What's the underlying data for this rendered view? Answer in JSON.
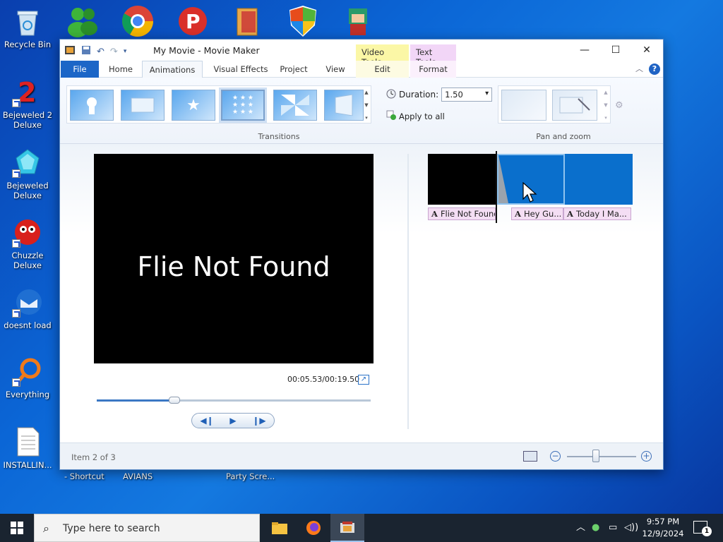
{
  "desktop": {
    "icons": [
      {
        "label": "Recycle Bin"
      },
      {
        "label": "Bejeweled 2 Deluxe"
      },
      {
        "label": "Bejeweled Deluxe"
      },
      {
        "label": "Chuzzle Deluxe"
      },
      {
        "label": "doesnt load"
      },
      {
        "label": "Everything"
      },
      {
        "label": "INSTALLIN..."
      }
    ],
    "partial_labels": [
      "- Shortcut",
      "AVIANS",
      "Party Scre..."
    ]
  },
  "window": {
    "title": "My Movie - Movie Maker",
    "context_tabs": {
      "video_tools": "Video Tools",
      "text_tools": "Text Tools"
    },
    "menu": {
      "file": "File",
      "home": "Home",
      "animations": "Animations",
      "visual_effects": "Visual Effects",
      "project": "Project",
      "view": "View",
      "edit": "Edit",
      "format": "Format"
    },
    "help_label": "?"
  },
  "ribbon": {
    "transitions_label": "Transitions",
    "duration_label": "Duration:",
    "duration_value": "1.50",
    "apply_all_label": "Apply to all",
    "pan_zoom_label": "Pan and zoom"
  },
  "preview": {
    "text": "Flie Not Found",
    "timecode": "00:05.53/00:19.50",
    "seek_progress": 0.284
  },
  "storyboard": {
    "clips": [
      {
        "caption": "Flie Not Found",
        "color": "#000000"
      },
      {
        "caption": "Hey Gu...",
        "color": "#0a6fcc"
      },
      {
        "caption": "Today I Ma...",
        "color": "#0a6fcc"
      }
    ]
  },
  "status": {
    "item_text": "Item 2 of 3",
    "zoom_minus": "−",
    "zoom_plus": "+"
  },
  "taskbar": {
    "search_placeholder": "Type here to search",
    "time": "9:57 PM",
    "date": "12/9/2024",
    "notification_count": "1"
  },
  "colors": {
    "accent": "#1c66c7",
    "video_tools": "#fbf7a6",
    "text_tools": "#f2d6f7"
  }
}
